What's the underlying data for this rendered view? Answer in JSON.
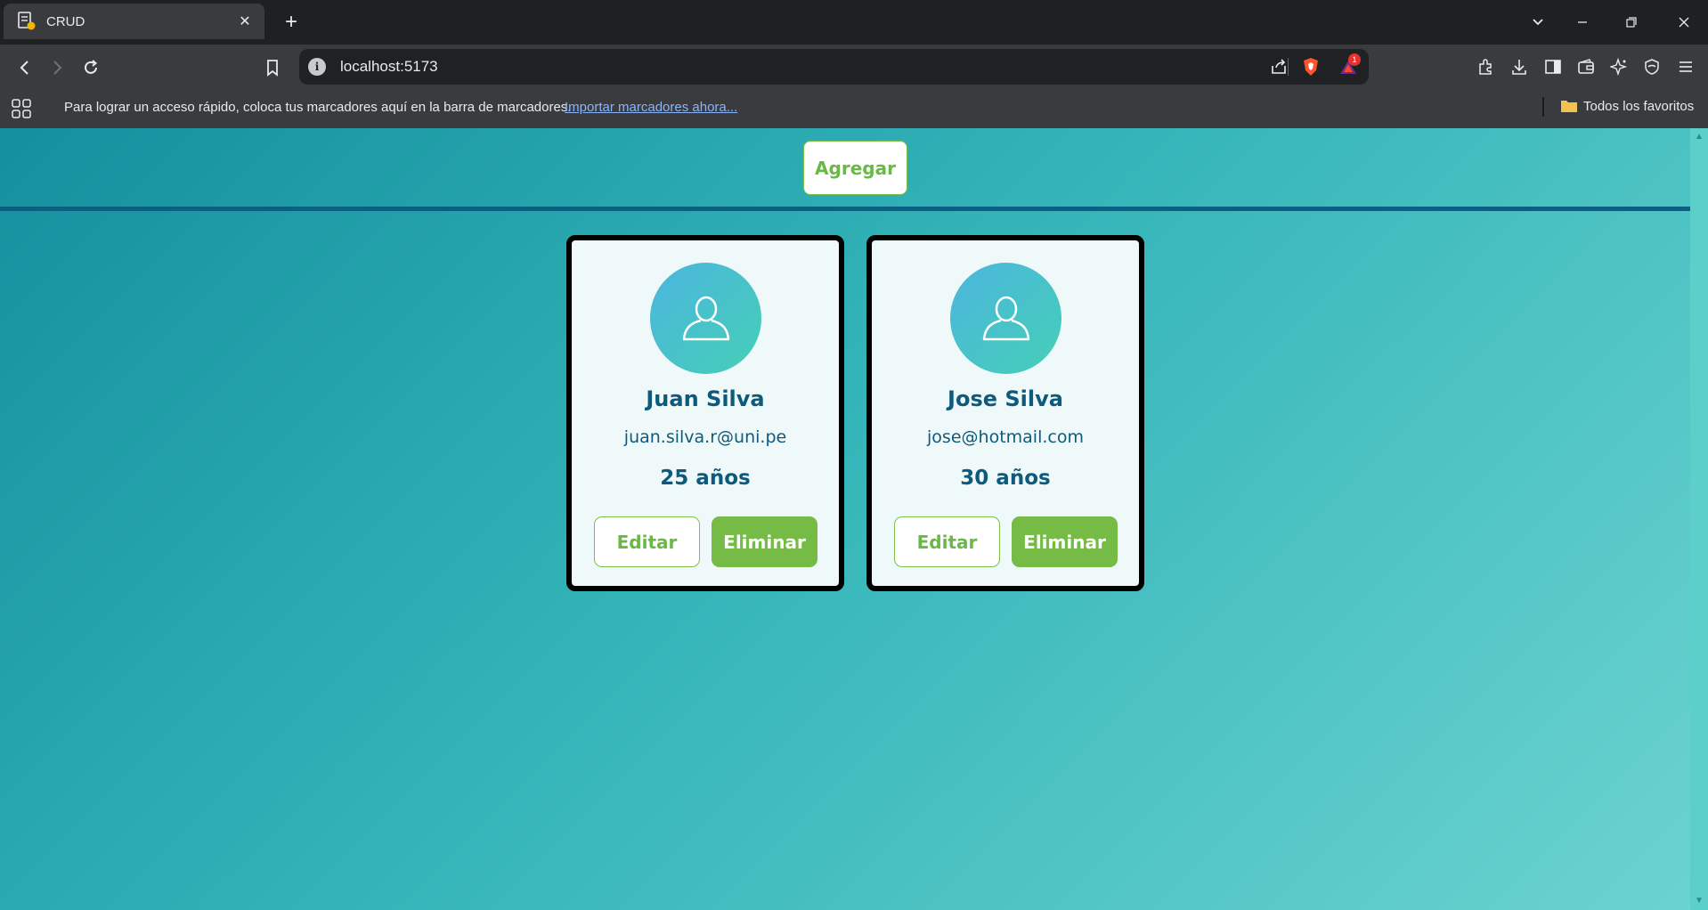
{
  "browser": {
    "tab_title": "CRUD",
    "url": "localhost:5173",
    "notification_count": "1",
    "bookmarks_bar_text": "Para lograr un acceso rápido, coloca tus marcadores aquí en la barra de marcadores.",
    "bookmarks_import_link": "Importar marcadores ahora...",
    "bookmarks_folder": "Todos los favoritos"
  },
  "page": {
    "add_button_label": "Agregar",
    "users": [
      {
        "name": "Juan Silva",
        "email": "juan.silva.r@uni.pe",
        "age": "25 años",
        "edit_label": "Editar",
        "delete_label": "Eliminar"
      },
      {
        "name": "Jose Silva",
        "email": "jose@hotmail.com",
        "age": "30 años",
        "edit_label": "Editar",
        "delete_label": "Eliminar"
      }
    ]
  },
  "colors": {
    "accent_green": "#75bb45",
    "text_blue": "#0d5a7c",
    "header_line": "#0b5f80"
  }
}
